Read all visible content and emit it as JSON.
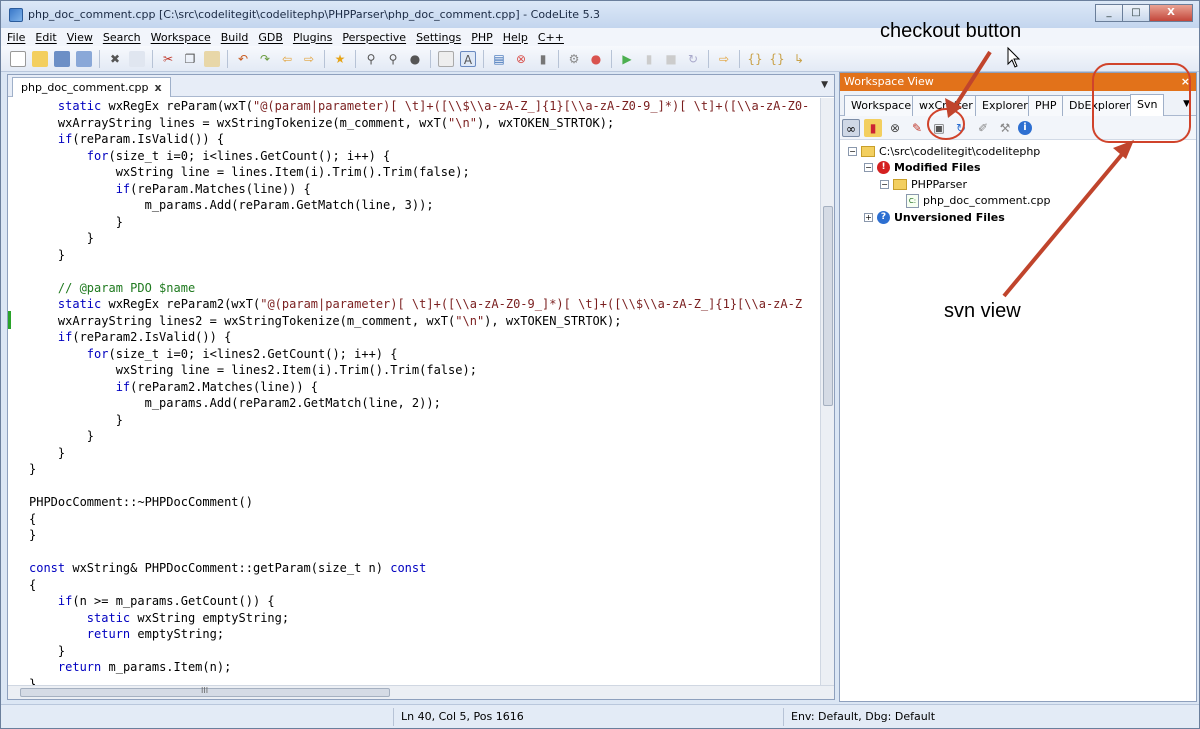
{
  "window": {
    "title": "php_doc_comment.cpp [C:\\src\\codelitegit\\codelitephp\\PHPParser\\php_doc_comment.cpp] - CodeLite 5.3",
    "min": "_",
    "max": "□",
    "close": "X"
  },
  "menu": [
    "File",
    "Edit",
    "View",
    "Search",
    "Workspace",
    "Build",
    "GDB",
    "Plugins",
    "Perspective",
    "Settings",
    "PHP",
    "Help",
    "C++"
  ],
  "toolbar_icons": [
    "new-file-icon",
    "open-file-icon",
    "save-icon",
    "save-all-icon",
    "close-icon",
    "close-all-icon",
    "cut-icon",
    "copy-icon",
    "paste-icon",
    "undo-icon",
    "redo-icon",
    "back-icon",
    "forward-icon",
    "bookmark-icon",
    "find-icon",
    "find-replace-icon",
    "find-in-files-icon",
    "highlight-icon",
    "word-wrap-icon",
    "build-icon",
    "stop-icon",
    "clean-icon",
    "rebuild-icon",
    "debug-icon",
    "run-icon",
    "pause-icon",
    "stop-debug-icon",
    "restart-icon",
    "next-icon",
    "step-in-icon",
    "step-out-icon",
    "show-cursor-icon"
  ],
  "editor": {
    "tab": "php_doc_comment.cpp",
    "tab_close": "x",
    "lines": [
      "    static wxRegEx reParam(wxT(\"@(param|parameter)[ \\t]+([\\\\$\\\\a-zA-Z_]{1}[\\\\a-zA-Z0-9_]*)[ \\t]+([\\\\a-zA-Z0-",
      "    wxArrayString lines = wxStringTokenize(m_comment, wxT(\"\\n\"), wxTOKEN_STRTOK);",
      "    if(reParam.IsValid()) {",
      "        for(size_t i=0; i<lines.GetCount(); i++) {",
      "            wxString line = lines.Item(i).Trim().Trim(false);",
      "            if(reParam.Matches(line)) {",
      "                m_params.Add(reParam.GetMatch(line, 3));",
      "            }",
      "        }",
      "    }",
      "",
      "    // @param PDO $name",
      "    static wxRegEx reParam2(wxT(\"@(param|parameter)[ \\t]+([\\\\a-zA-Z0-9_]*)[ \\t]+([\\\\$\\\\a-zA-Z_]{1}[\\\\a-zA-Z",
      "    wxArrayString lines2 = wxStringTokenize(m_comment, wxT(\"\\n\"), wxTOKEN_STRTOK);",
      "    if(reParam2.IsValid()) {",
      "        for(size_t i=0; i<lines2.GetCount(); i++) {",
      "            wxString line = lines2.Item(i).Trim().Trim(false);",
      "            if(reParam2.Matches(line)) {",
      "                m_params.Add(reParam2.GetMatch(line, 2));",
      "            }",
      "        }",
      "    }",
      "}",
      "",
      "PHPDocComment::~PHPDocComment()",
      "{",
      "}",
      "",
      "const wxString& PHPDocComment::getParam(size_t n) const",
      "{",
      "    if(n >= m_params.GetCount()) {",
      "        static wxString emptyString;",
      "        return emptyString;",
      "    }",
      "    return m_params.Item(n);",
      "}"
    ]
  },
  "workspace": {
    "title": "Workspace View",
    "close": "×",
    "tabs": [
      "Workspace",
      "wxCrafter",
      "Explorer",
      "PHP",
      "DbExplorer",
      "Svn"
    ],
    "tools": [
      "svn-link-icon",
      "svn-folder-icon",
      "stop-icon",
      "clear-icon",
      "checkout-icon",
      "refresh-icon",
      "brush-icon",
      "settings-icon",
      "info-icon"
    ],
    "tree": {
      "root": "C:\\src\\codelitegit\\codelitephp",
      "modified": "Modified Files",
      "folder": "PHPParser",
      "file": "php_doc_comment.cpp",
      "unversioned": "Unversioned Files",
      "minus": "−",
      "plus": "+",
      "cpp_badge": "C:"
    }
  },
  "status": {
    "position": "Ln 40,  Col 5,  Pos 1616",
    "env": "Env: Default, Dbg: Default"
  },
  "annotations": {
    "checkout": "checkout button",
    "svn_view": "svn view",
    "color": "#d0432b"
  }
}
